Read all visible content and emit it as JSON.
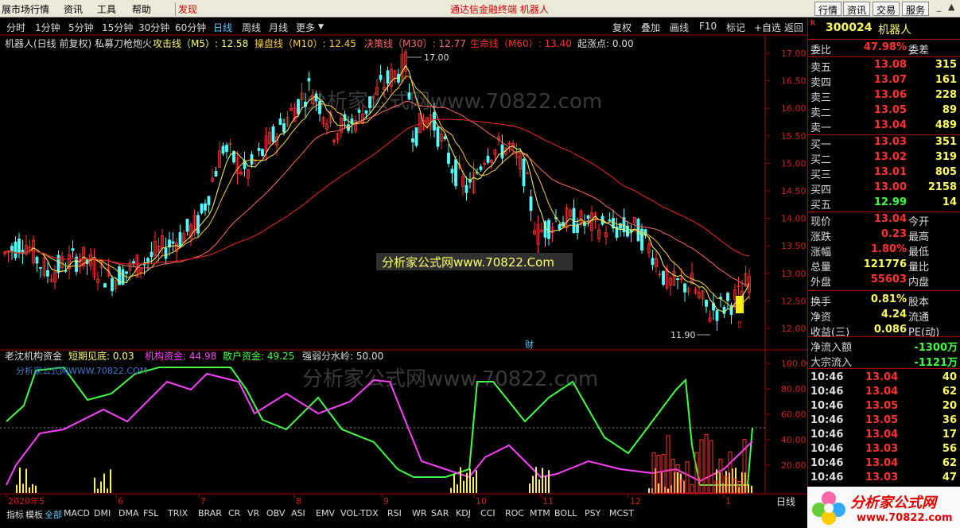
{
  "menu": {
    "items": [
      "展市场行情",
      "资讯",
      "工具",
      "帮助"
    ],
    "discover": "发现",
    "center_title": "通达信金融终端   机器人",
    "right_buttons": [
      "行情",
      "资讯",
      "交易",
      "服务"
    ]
  },
  "periods": [
    "分时",
    "1分钟",
    "5分钟",
    "15分钟",
    "30分钟",
    "60分钟",
    "日线",
    "周线",
    "月线",
    "更多"
  ],
  "active_period": "日线",
  "toolbar_buttons": [
    "复权",
    "叠加",
    "画线",
    "F10",
    "标记",
    "+自选",
    "返回"
  ],
  "main_indicator": {
    "title": "机器人(日线 前复权) 私募刀枪炮火",
    "items": [
      {
        "label": "攻击线（M5）: 12.58",
        "color": "#ffff66"
      },
      {
        "label": "操盘线（M10）: 12.45",
        "color": "#ffcc33"
      },
      {
        "label": "决策线（M30）: 12.77",
        "color": "#ff6666"
      },
      {
        "label": "生命线（M60）: 13.40",
        "color": "#ff3030"
      },
      {
        "label": "起涨点: 0.00",
        "color": "#dddddd"
      }
    ],
    "high_label": "17.00",
    "low_label": "11.90",
    "cai_label": "财",
    "y_ticks": [
      "17.00",
      "16.50",
      "16.00",
      "15.50",
      "15.00",
      "14.50",
      "14.00",
      "13.50",
      "13.00",
      "12.50",
      "12.00"
    ]
  },
  "sub_indicator": {
    "title": "老沈机构资金",
    "items": [
      {
        "label": "短期见底: 0.03",
        "color": "#ffff66"
      },
      {
        "label": "机构资金: 44.98",
        "color": "#ff40ff"
      },
      {
        "label": "散户资金: 49.25",
        "color": "#40ff40"
      },
      {
        "label": "强弱分水岭: 50.00",
        "color": "#dddddd"
      }
    ],
    "y_ticks": [
      "100.00",
      "80.00",
      "60.00",
      "40.00",
      "20.00"
    ]
  },
  "watermarks": {
    "big": "分析家公式网www.70822.com",
    "banner": "分析家公式网www.70822.Com",
    "small": "分析家公式网WWW.70822.COM"
  },
  "x_axis": [
    "2020年5",
    "6",
    "7",
    "8",
    "9",
    "10",
    "11",
    "12",
    "1"
  ],
  "x_period_label": "日线",
  "bottom_tabs": [
    "指标",
    "模板",
    "全部",
    "MACD",
    "DMI",
    "DMA",
    "FSL",
    "TRIX",
    "BRAR",
    "CR",
    "VR",
    "OBV",
    "ASI",
    "EMV",
    "VOL-TDX",
    "RSI",
    "WR",
    "SAR",
    "KDJ",
    "CCI",
    "ROC",
    "MTM",
    "BOLL",
    "PSY",
    "MCST"
  ],
  "active_bottom_tab": "全部",
  "quote": {
    "code": "300024",
    "name": "机器人",
    "weibi_label": "委比",
    "weibi_value": "47.98%",
    "weicha_label": "委差",
    "sells": [
      {
        "label": "卖五",
        "price": "13.08",
        "vol": "315"
      },
      {
        "label": "卖四",
        "price": "13.07",
        "vol": "161"
      },
      {
        "label": "卖三",
        "price": "13.06",
        "vol": "228"
      },
      {
        "label": "卖二",
        "price": "13.05",
        "vol": "89"
      },
      {
        "label": "卖一",
        "price": "13.04",
        "vol": "489"
      }
    ],
    "buys": [
      {
        "label": "买一",
        "price": "13.03",
        "vol": "351"
      },
      {
        "label": "买二",
        "price": "13.02",
        "vol": "319"
      },
      {
        "label": "买三",
        "price": "13.01",
        "vol": "805"
      },
      {
        "label": "买四",
        "price": "13.00",
        "vol": "2158"
      },
      {
        "label": "买五",
        "price": "12.99",
        "vol": "14"
      }
    ],
    "stats": [
      {
        "l1": "现价",
        "v1": "13.04",
        "l2": "今开"
      },
      {
        "l1": "涨跌",
        "v1": "0.23",
        "l2": "最高"
      },
      {
        "l1": "涨幅",
        "v1": "1.80%",
        "l2": "最低"
      },
      {
        "l1": "总量",
        "v1": "121776",
        "l2": "量比"
      },
      {
        "l1": "外盘",
        "v1": "55603",
        "l2": "内盘"
      }
    ],
    "stats2": [
      {
        "l1": "换手",
        "v1": "0.81%",
        "l2": "股本"
      },
      {
        "l1": "净资",
        "v1": "4.24",
        "l2": "流通"
      },
      {
        "l1": "收益(三)",
        "v1": "0.086",
        "l2": "PE(动)"
      }
    ],
    "flows": [
      {
        "label": "净流入额",
        "value": "-1300万"
      },
      {
        "label": "大宗流入",
        "value": "-1121万"
      }
    ],
    "ticks": [
      {
        "time": "10:46",
        "price": "13.04",
        "vol": "40"
      },
      {
        "time": "10:46",
        "price": "13.04",
        "vol": "62"
      },
      {
        "time": "10:46",
        "price": "13.05",
        "vol": "20"
      },
      {
        "time": "10:46",
        "price": "13.05",
        "vol": "36"
      },
      {
        "time": "10:46",
        "price": "13.04",
        "vol": "17"
      },
      {
        "time": "10:46",
        "price": "13.03",
        "vol": "56"
      },
      {
        "time": "10:46",
        "price": "13.04",
        "vol": "62"
      },
      {
        "time": "10:46",
        "price": "13.03",
        "vol": "47"
      }
    ]
  },
  "logo_text": "分析家公式网",
  "logo_url": "www.70822.com",
  "colors": {
    "up": "#ff3232",
    "down": "#54ffff",
    "ma5": "#ffff66",
    "ma10": "#ffcc33",
    "ma30": "#ff6666",
    "ma60": "#d02020",
    "inst": "#ff40ff",
    "retail": "#40ff40",
    "axis": "#a00000"
  }
}
